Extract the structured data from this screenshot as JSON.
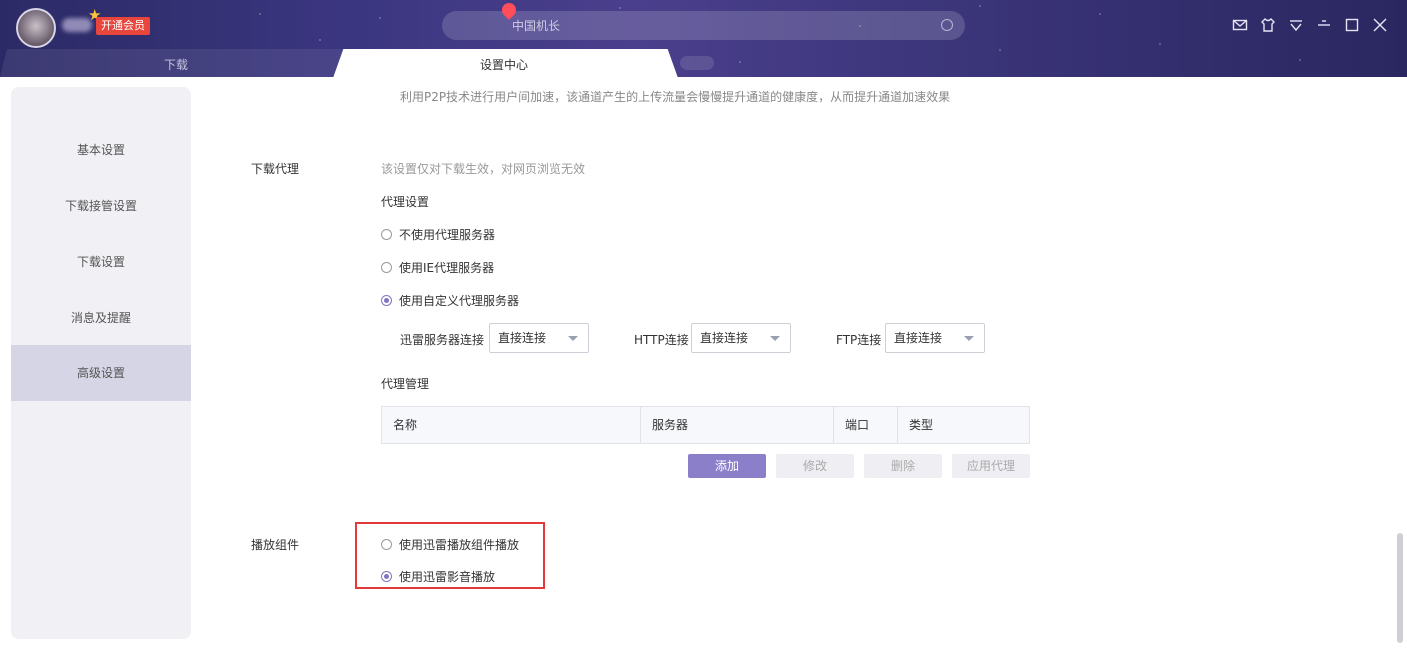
{
  "header": {
    "vip_badge": "开通会员",
    "search_placeholder": "中国机长",
    "tabs": {
      "download": "下载",
      "settings": "设置中心"
    }
  },
  "sidebar": {
    "items": [
      {
        "label": "基本设置"
      },
      {
        "label": "下载接管设置"
      },
      {
        "label": "下载设置"
      },
      {
        "label": "消息及提醒"
      },
      {
        "label": "高级设置"
      }
    ],
    "active_index": 4
  },
  "main": {
    "top_description": "利用P2P技术进行用户间加速，该通道产生的上传流量会慢慢提升通道的健康度，从而提升通道加速效果",
    "download_proxy": {
      "label": "下载代理",
      "hint": "该设置仅对下载生效，对网页浏览无效",
      "proxy_settings_heading": "代理设置",
      "options": [
        {
          "label": "不使用代理服务器",
          "checked": false
        },
        {
          "label": "使用IE代理服务器",
          "checked": false
        },
        {
          "label": "使用自定义代理服务器",
          "checked": true
        }
      ],
      "connections": [
        {
          "label": "迅雷服务器连接",
          "value": "直接连接"
        },
        {
          "label": "HTTP连接",
          "value": "直接连接"
        },
        {
          "label": "FTP连接",
          "value": "直接连接"
        }
      ],
      "management_heading": "代理管理",
      "table_headers": [
        "名称",
        "服务器",
        "端口",
        "类型"
      ],
      "buttons": {
        "add": "添加",
        "edit": "修改",
        "delete": "删除",
        "apply": "应用代理"
      }
    },
    "playback": {
      "label": "播放组件",
      "options": [
        {
          "label": "使用迅雷播放组件播放",
          "checked": false
        },
        {
          "label": "使用迅雷影音播放",
          "checked": true
        }
      ]
    }
  },
  "colors": {
    "accent": "#8b7fc9",
    "highlight_border": "#e23a3a",
    "sidebar_bg": "#f0f0f5",
    "sidebar_active": "#d5d5e6"
  }
}
